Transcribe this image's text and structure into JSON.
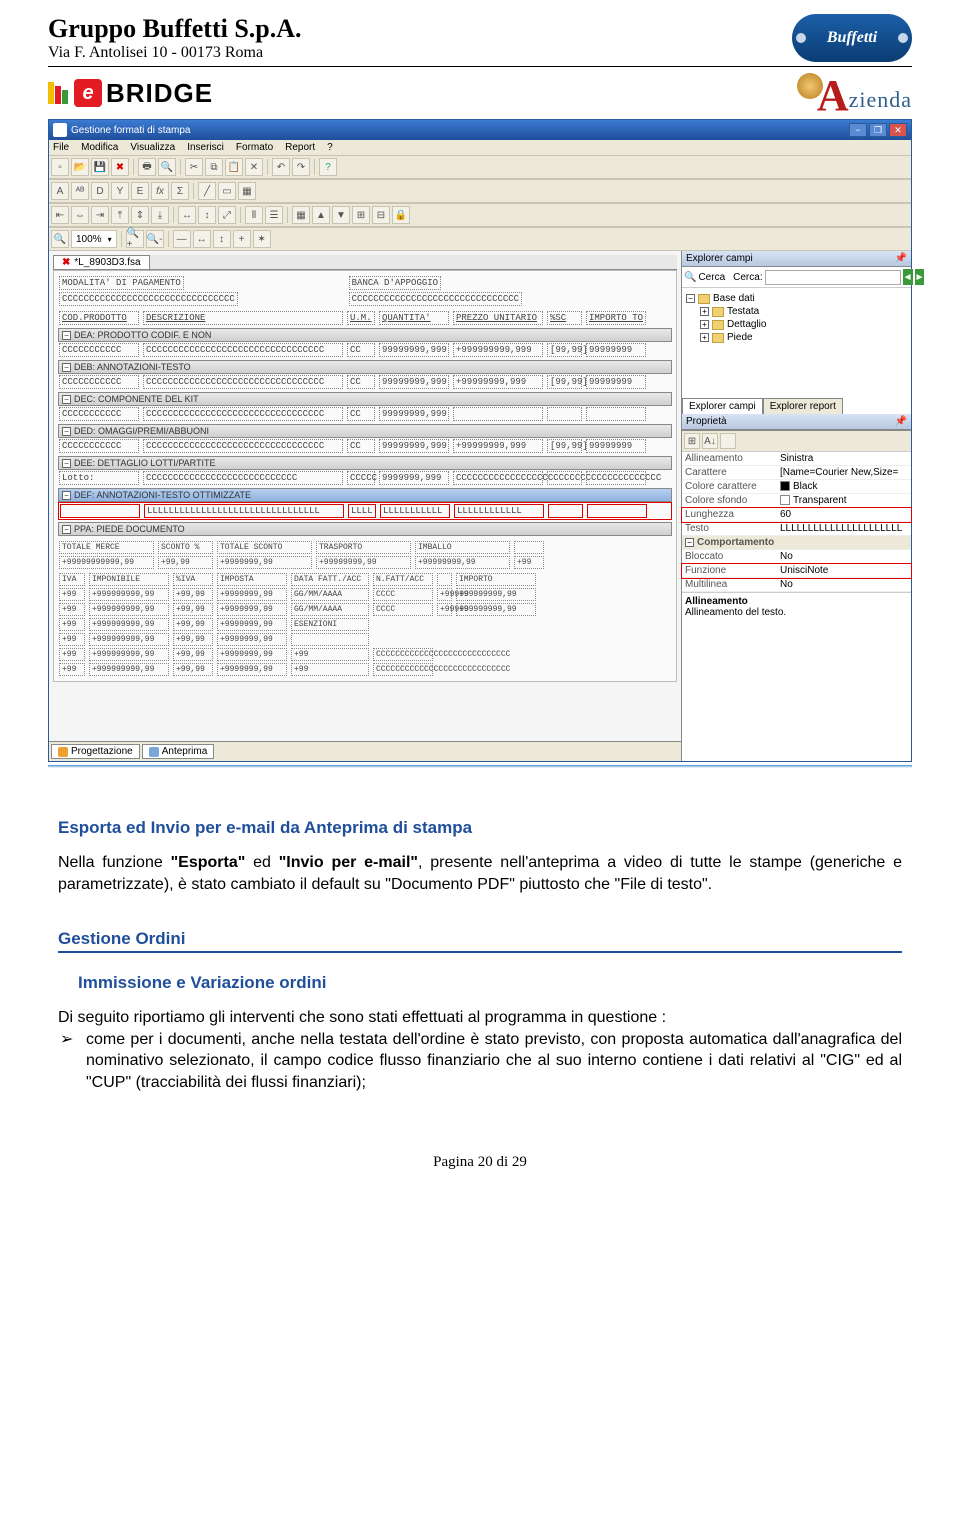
{
  "header": {
    "company": "Gruppo Buffetti S.p.A.",
    "address": "Via F. Antolisei 10 - 00173 Roma",
    "logo_text": "Buffetti"
  },
  "brands": {
    "ebridge": "BRIDGE",
    "azienda_a": "A",
    "azienda_rest": "zienda"
  },
  "window": {
    "title": "Gestione formati di stampa",
    "menus": [
      "File",
      "Modifica",
      "Visualizza",
      "Inserisci",
      "Formato",
      "Report",
      "?"
    ],
    "zoom": "100%",
    "tab_label": "*L_8903D3.fsa",
    "bottom_tabs": [
      "Progettazione",
      "Anteprima"
    ]
  },
  "layout": {
    "header_row1_left": "MODALITA' DI PAGAMENTO",
    "header_row1_right": "BANCA D'APPOGGIO",
    "header_row1_c": "CCCCCCCCCCCCCCCCCCCCCCCCCCCCCCCC",
    "header_row1_c2": "CCCCCCCCCCCCCCCCCCCCCCCCCCCCCCC",
    "cols": [
      "COD.PRODOTTO",
      "DESCRIZIONE",
      "U.M.",
      "QUANTITA'",
      "PREZZO UNITARIO",
      "%SC",
      "IMPORTO TO"
    ],
    "sections": [
      {
        "title": "DEA: PRODOTTO CODIF. E NON",
        "row": [
          "CCCCCCCCCCC",
          "CCCCCCCCCCCCCCCCCCCCCCCCCCCCCCCCC",
          "CC",
          "99999999,999",
          "+999999999,999",
          "[99,99]",
          "99999999"
        ]
      },
      {
        "title": "DEB: ANNOTAZIONI-TESTO",
        "row": [
          "CCCCCCCCCCC",
          "CCCCCCCCCCCCCCCCCCCCCCCCCCCCCCCCC",
          "CC",
          "99999999,999",
          "+99999999,999",
          "[99,99]",
          "99999999"
        ]
      },
      {
        "title": "DEC: COMPONENTE DEL KIT",
        "row": [
          "CCCCCCCCCCC",
          "CCCCCCCCCCCCCCCCCCCCCCCCCCCCCCCCC",
          "CC",
          "99999999,999",
          "",
          "",
          ""
        ]
      },
      {
        "title": "DED: OMAGGI/PREMI/ABBUONI",
        "row": [
          "CCCCCCCCCCC",
          "CCCCCCCCCCCCCCCCCCCCCCCCCCCCCCCCC",
          "CC",
          "99999999,999",
          "+99999999,999",
          "[99,99]",
          "99999999"
        ]
      },
      {
        "title": "DEE: DETTAGLIO LOTTI/PARTITE",
        "row": [
          "Lotto:",
          "CCCCCCCCCCCCCCCCCCCCCCCCCCCC",
          "CCCCC",
          "9999999,999",
          "CCCCCCCCCCCCCCCCCCCCCCCCCCCCCCCCCCCCCC",
          "",
          ""
        ]
      },
      {
        "title": "DEF: ANNOTAZIONI-TESTO OTTIMIZZATE",
        "row": [
          "",
          "LLLLLLLLLLLLLLLLLLLLLLLLLLLLLLLL",
          "LLLL",
          "LLLLLLLLLLL",
          "LLLLLLLLLLLL",
          "",
          ""
        ],
        "selected": true
      },
      {
        "title": "PPA: PIEDE DOCUMENTO",
        "row": []
      }
    ],
    "footer_cols1": [
      "TOTALE MERCE",
      "SCONTO %",
      "TOTALE SCONTO",
      "TRASPORTO",
      "IMBALLO",
      ""
    ],
    "footer_vals1": [
      "+99999999999,99",
      "+99,99",
      "+9999999,99",
      "+99999999,99",
      "+99999999,99",
      "+99"
    ],
    "footer_cols2": [
      "IVA",
      "IMPONIBILE",
      "%IVA",
      "IMPOSTA",
      "DATA FATT./ACC",
      "N.FATT/ACC",
      "",
      "IMPORTO"
    ],
    "footer_line": [
      "+99",
      "+999999999,99",
      "+99,99",
      "+9999999,99",
      "GG/MM/AAAA",
      "CCCC",
      "+99999",
      "+99999999,99"
    ],
    "footer_line2": [
      "+99",
      "+999999999,99",
      "+99,99",
      "+9999999,99",
      "GG/MM/AAAA",
      "CCCC",
      "+99999",
      "+99999999,99"
    ],
    "footer_line3": [
      "+99",
      "+999999999,99",
      "+99,99",
      "+9999999,99",
      "ESENZIONI",
      "",
      "",
      ""
    ],
    "footer_line4": [
      "+99",
      "+999999999,99",
      "+99,99",
      "+9999999,99",
      "",
      "",
      "",
      ""
    ],
    "footer_line5": [
      "+99",
      "+999999999,99",
      "+99,99",
      "+9999999,99",
      "+99",
      "CCCCCCCCCCCCCCCCCCCCCCCCCCCC",
      "",
      ""
    ],
    "footer_line6": [
      "+99",
      "+999999999,99",
      "+99,99",
      "+9999999,99",
      "+99",
      "CCCCCCCCCCCCCCCCCCCCCCCCCCCC",
      "",
      ""
    ]
  },
  "explorer": {
    "title": "Explorer campi",
    "search_label": "Cerca",
    "search_label2": "Cerca:",
    "tree": [
      {
        "label": "Base dati",
        "expanded": false,
        "root": true
      },
      {
        "label": "Testata",
        "sub": true
      },
      {
        "label": "Dettaglio",
        "sub": true
      },
      {
        "label": "Piede",
        "sub": true
      }
    ],
    "tabs": [
      "Explorer campi",
      "Explorer report"
    ]
  },
  "properties": {
    "title": "Proprietà",
    "rows": [
      {
        "k": "Allineamento",
        "v": "Sinistra"
      },
      {
        "k": "Carattere",
        "v": "[Name=Courier New,Size="
      },
      {
        "k": "Colore carattere",
        "v": "Black",
        "swatch": "#000"
      },
      {
        "k": "Colore sfondo",
        "v": "Transparent",
        "swatch": "#fff"
      },
      {
        "k": "Lunghezza",
        "v": "60",
        "sel": true
      },
      {
        "k": "Testo",
        "v": "LLLLLLLLLLLLLLLLLLLLLL"
      }
    ],
    "cat2": "Comportamento",
    "rows2": [
      {
        "k": "Bloccato",
        "v": "No"
      },
      {
        "k": "Funzione",
        "v": "UnisciNote",
        "sel": true
      },
      {
        "k": "Multilinea",
        "v": "No"
      }
    ],
    "desc_title": "Allineamento",
    "desc_text": "Allineamento del testo."
  },
  "body": {
    "h1": "Esporta ed Invio per e-mail da Anteprima di stampa",
    "p1a": "Nella funzione ",
    "p1b": "\"Esporta\"",
    "p1c": " ed ",
    "p1d": "\"Invio per e-mail\"",
    "p1e": ", presente nell'anteprima a video di tutte le stampe (generiche e parametrizzate), è stato cambiato il default su \"Documento PDF\" piuttosto che \"File di testo\".",
    "section": "Gestione Ordini",
    "h2": "Immissione e Variazione ordini",
    "p2": "Di seguito riportiamo gli interventi che sono stati effettuati al programma in questione :",
    "li1": "come per i documenti, anche nella testata dell'ordine è stato previsto, con proposta automatica dall'anagrafica del nominativo selezionato, il campo codice flusso finanziario che al suo interno contiene i dati relativi al \"CIG\" ed al \"CUP\" (tracciabilità dei flussi finanziari);"
  },
  "footer": "Pagina 20 di 29"
}
